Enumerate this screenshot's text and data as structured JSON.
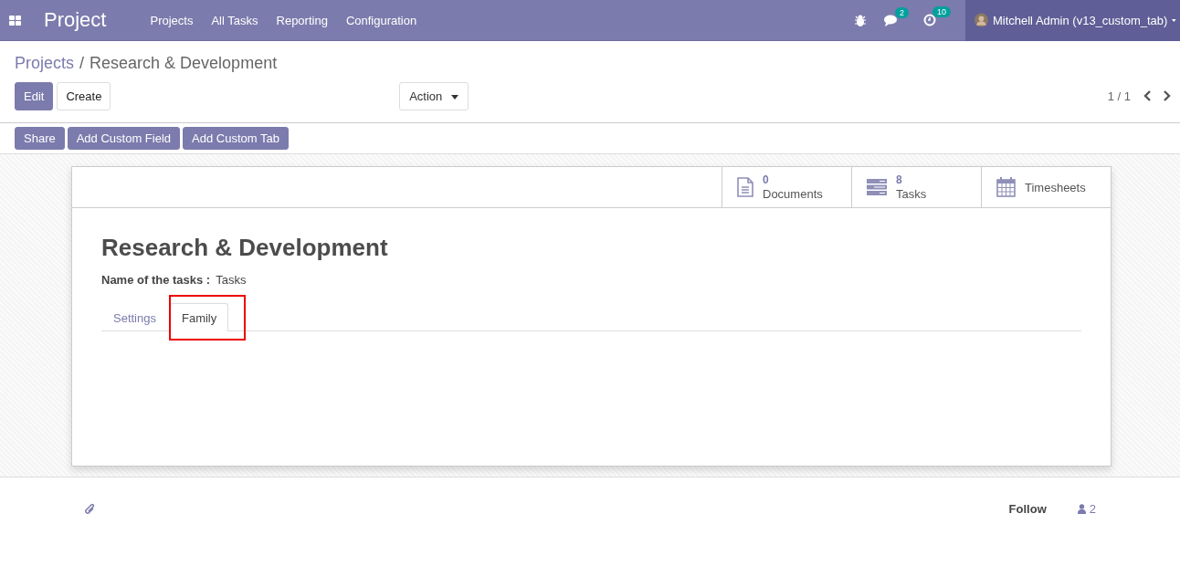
{
  "navbar": {
    "app_name": "Project",
    "menu": [
      "Projects",
      "All Tasks",
      "Reporting",
      "Configuration"
    ],
    "messages_count": "2",
    "activities_count": "10",
    "user": "Mitchell Admin (v13_custom_tab)"
  },
  "breadcrumb": [
    {
      "label": "Projects",
      "kind": "link"
    },
    {
      "label": "/",
      "kind": "separator"
    },
    {
      "label": "Research & Development",
      "kind": "current"
    }
  ],
  "buttons": [
    {
      "label": "Edit",
      "kind": "primary"
    },
    {
      "label": "Create",
      "kind": "secondary"
    }
  ],
  "action_menu": "Action",
  "pager": "1 / 1",
  "custom_buttons": [
    "Share",
    "Add Custom Field",
    "Add Custom Tab"
  ],
  "smart_buttons": [
    {
      "kind": "document",
      "value": "0",
      "label": "Documents"
    },
    {
      "kind": "tasks",
      "value": "8",
      "label": "Tasks"
    },
    {
      "kind": "calendar",
      "label": "Timesheets"
    }
  ],
  "record": {
    "title": "Research & Development",
    "field_label": "Name of the tasks :",
    "field_value": "Tasks"
  },
  "tabs": [
    {
      "label": "Settings",
      "selected": false,
      "highlighted": false
    },
    {
      "label": "Family",
      "selected": true,
      "highlighted": true
    }
  ],
  "chatter": {
    "follow": "Follow",
    "followers": "2"
  }
}
